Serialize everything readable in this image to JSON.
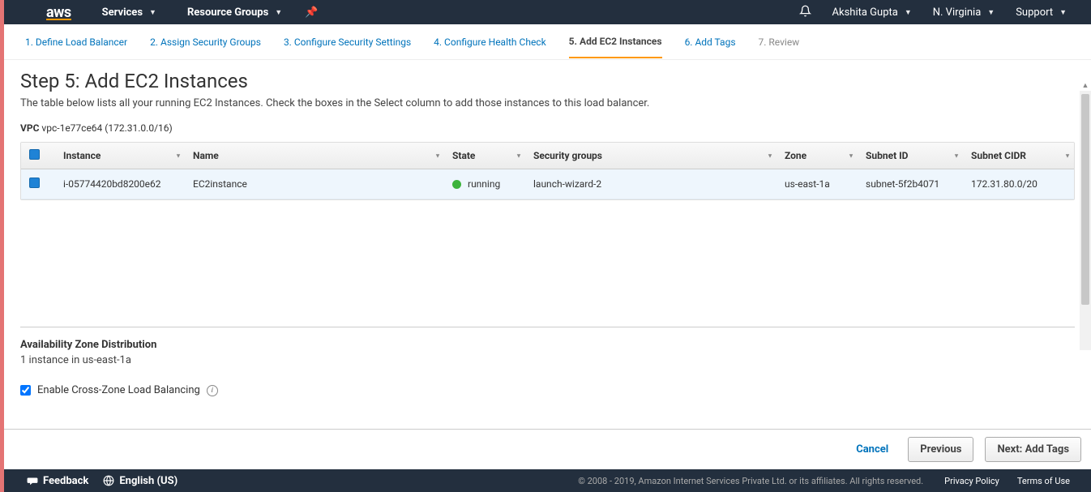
{
  "nav": {
    "logo": "aws",
    "services": "Services",
    "resource_groups": "Resource Groups",
    "user": "Akshita Gupta",
    "region": "N. Virginia",
    "support": "Support"
  },
  "wizard": {
    "steps": [
      "1. Define Load Balancer",
      "2. Assign Security Groups",
      "3. Configure Security Settings",
      "4. Configure Health Check",
      "5. Add EC2 Instances",
      "6. Add Tags",
      "7. Review"
    ],
    "active_index": 4
  },
  "page": {
    "title": "Step 5: Add EC2 Instances",
    "subtitle": "The table below lists all your running EC2 Instances. Check the boxes in the Select column to add those instances to this load balancer.",
    "vpc_label": "VPC",
    "vpc_value": "vpc-1e77ce64 (172.31.0.0/16)"
  },
  "table": {
    "headers": {
      "instance": "Instance",
      "name": "Name",
      "state": "State",
      "security_groups": "Security groups",
      "zone": "Zone",
      "subnet_id": "Subnet ID",
      "subnet_cidr": "Subnet CIDR"
    },
    "rows": [
      {
        "selected": true,
        "instance": "i-05774420bd8200e62",
        "name": "EC2instance",
        "state": "running",
        "security_groups": "launch-wizard-2",
        "zone": "us-east-1a",
        "subnet_id": "subnet-5f2b4071",
        "subnet_cidr": "172.31.80.0/20"
      }
    ]
  },
  "azd": {
    "title": "Availability Zone Distribution",
    "text": "1 instance in us-east-1a"
  },
  "cross_zone": {
    "label": "Enable Cross-Zone Load Balancing",
    "checked": true
  },
  "buttons": {
    "cancel": "Cancel",
    "previous": "Previous",
    "next": "Next: Add Tags"
  },
  "footer": {
    "feedback": "Feedback",
    "language": "English (US)",
    "copyright": "© 2008 - 2019, Amazon Internet Services Private Ltd. or its affiliates. All rights reserved.",
    "privacy": "Privacy Policy",
    "terms": "Terms of Use"
  }
}
